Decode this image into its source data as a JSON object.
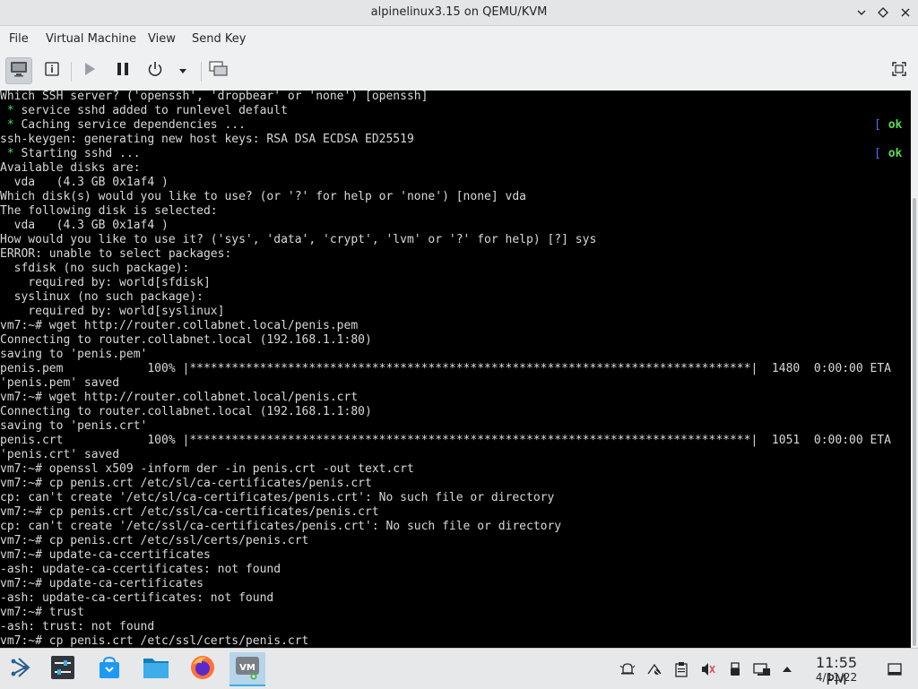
{
  "window": {
    "title": "alpinelinux3.15 on QEMU/KVM",
    "controls": [
      "minimize",
      "maximize",
      "close"
    ]
  },
  "menubar": {
    "items": [
      "File",
      "Virtual Machine",
      "View",
      "Send Key"
    ]
  },
  "toolbar": {
    "buttons": [
      "console-view",
      "details-view",
      "run",
      "pause",
      "shutdown",
      "shutdown-menu",
      "snapshots",
      "fullscreen"
    ]
  },
  "console": {
    "lines": [
      "Which SSH server? ('openssh', 'dropbear' or 'none') [openssh]",
      " * service sshd added to runlevel default",
      " * Caching service dependencies ...",
      "ssh-keygen: generating new host keys: RSA DSA ECDSA ED25519",
      " * Starting sshd ...",
      "Available disks are:",
      "  vda   (4.3 GB 0x1af4 )",
      "Which disk(s) would you like to use? (or '?' for help or 'none') [none] vda",
      "The following disk is selected:",
      "  vda   (4.3 GB 0x1af4 )",
      "How would you like to use it? ('sys', 'data', 'crypt', 'lvm' or '?' for help) [?] sys",
      "ERROR: unable to select packages:",
      "  sfdisk (no such package):",
      "    required by: world[sfdisk]",
      "  syslinux (no such package):",
      "    required by: world[syslinux]",
      "vm7:~# wget http://router.collabnet.local/penis.pem",
      "Connecting to router.collabnet.local (192.168.1.1:80)",
      "saving to 'penis.pem'",
      "penis.pem            100% |********************************************************************************|  1480  0:00:00 ETA",
      "'penis.pem' saved",
      "vm7:~# wget http://router.collabnet.local/penis.crt",
      "Connecting to router.collabnet.local (192.168.1.1:80)",
      "saving to 'penis.crt'",
      "penis.crt            100% |********************************************************************************|  1051  0:00:00 ETA",
      "'penis.crt' saved",
      "vm7:~# openssl x509 -inform der -in penis.crt -out text.crt",
      "vm7:~# cp penis.crt /etc/sl/ca-certificates/penis.crt",
      "cp: can't create '/etc/sl/ca-certificates/penis.crt': No such file or directory",
      "vm7:~# cp penis.crt /etc/ssl/ca-certificates/penis.crt",
      "cp: can't create '/etc/ssl/ca-certificates/penis.crt': No such file or directory",
      "vm7:~# cp penis.crt /etc/ssl/certs/penis.crt",
      "vm7:~# update-ca-ccertificates",
      "-ash: update-ca-ccertificates: not found",
      "vm7:~# update-ca-certificates",
      "-ash: update-ca-certificates: not found",
      "vm7:~# trust",
      "-ash: trust: not found",
      "vm7:~# cp penis.crt /etc/ssl/certs/penis.crt"
    ],
    "ok_markers": [
      {
        "line": 2,
        "open": "[ ",
        "text": "ok",
        "close": " ]"
      },
      {
        "line": 4,
        "open": "[ ",
        "text": "ok",
        "close": " ]"
      }
    ],
    "colors": {
      "background": "#000000",
      "text": "#d8d8d8",
      "ok": "#55dd55",
      "bracket": "#5566ff"
    }
  },
  "taskbar": {
    "tasks": [
      "application-launcher",
      "system-settings",
      "discover",
      "file-manager",
      "firefox",
      "virt-manager"
    ],
    "active_task": "virt-manager",
    "tray_icons": [
      "notifications-icon",
      "network-manager-icon",
      "clipboard-icon",
      "volume-muted-icon",
      "usb-device-icon",
      "display-icon",
      "expand-tray-icon"
    ],
    "clock": {
      "time": "11:55 PM",
      "date": "4/11/22"
    }
  }
}
